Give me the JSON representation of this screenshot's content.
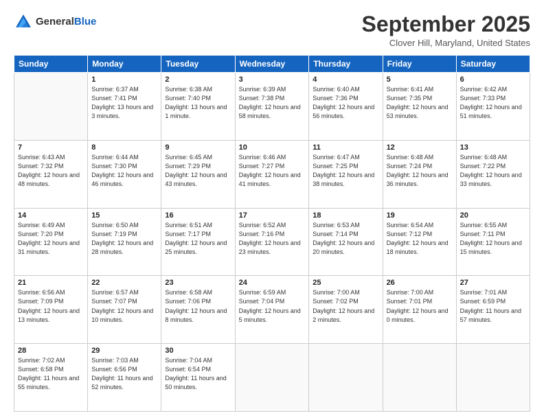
{
  "logo": {
    "general": "General",
    "blue": "Blue"
  },
  "header": {
    "month": "September 2025",
    "location": "Clover Hill, Maryland, United States"
  },
  "days_of_week": [
    "Sunday",
    "Monday",
    "Tuesday",
    "Wednesday",
    "Thursday",
    "Friday",
    "Saturday"
  ],
  "weeks": [
    [
      {
        "day": "",
        "sunrise": "",
        "sunset": "",
        "daylight": ""
      },
      {
        "day": "1",
        "sunrise": "Sunrise: 6:37 AM",
        "sunset": "Sunset: 7:41 PM",
        "daylight": "Daylight: 13 hours and 3 minutes."
      },
      {
        "day": "2",
        "sunrise": "Sunrise: 6:38 AM",
        "sunset": "Sunset: 7:40 PM",
        "daylight": "Daylight: 13 hours and 1 minute."
      },
      {
        "day": "3",
        "sunrise": "Sunrise: 6:39 AM",
        "sunset": "Sunset: 7:38 PM",
        "daylight": "Daylight: 12 hours and 58 minutes."
      },
      {
        "day": "4",
        "sunrise": "Sunrise: 6:40 AM",
        "sunset": "Sunset: 7:36 PM",
        "daylight": "Daylight: 12 hours and 56 minutes."
      },
      {
        "day": "5",
        "sunrise": "Sunrise: 6:41 AM",
        "sunset": "Sunset: 7:35 PM",
        "daylight": "Daylight: 12 hours and 53 minutes."
      },
      {
        "day": "6",
        "sunrise": "Sunrise: 6:42 AM",
        "sunset": "Sunset: 7:33 PM",
        "daylight": "Daylight: 12 hours and 51 minutes."
      }
    ],
    [
      {
        "day": "7",
        "sunrise": "Sunrise: 6:43 AM",
        "sunset": "Sunset: 7:32 PM",
        "daylight": "Daylight: 12 hours and 48 minutes."
      },
      {
        "day": "8",
        "sunrise": "Sunrise: 6:44 AM",
        "sunset": "Sunset: 7:30 PM",
        "daylight": "Daylight: 12 hours and 46 minutes."
      },
      {
        "day": "9",
        "sunrise": "Sunrise: 6:45 AM",
        "sunset": "Sunset: 7:29 PM",
        "daylight": "Daylight: 12 hours and 43 minutes."
      },
      {
        "day": "10",
        "sunrise": "Sunrise: 6:46 AM",
        "sunset": "Sunset: 7:27 PM",
        "daylight": "Daylight: 12 hours and 41 minutes."
      },
      {
        "day": "11",
        "sunrise": "Sunrise: 6:47 AM",
        "sunset": "Sunset: 7:25 PM",
        "daylight": "Daylight: 12 hours and 38 minutes."
      },
      {
        "day": "12",
        "sunrise": "Sunrise: 6:48 AM",
        "sunset": "Sunset: 7:24 PM",
        "daylight": "Daylight: 12 hours and 36 minutes."
      },
      {
        "day": "13",
        "sunrise": "Sunrise: 6:48 AM",
        "sunset": "Sunset: 7:22 PM",
        "daylight": "Daylight: 12 hours and 33 minutes."
      }
    ],
    [
      {
        "day": "14",
        "sunrise": "Sunrise: 6:49 AM",
        "sunset": "Sunset: 7:20 PM",
        "daylight": "Daylight: 12 hours and 31 minutes."
      },
      {
        "day": "15",
        "sunrise": "Sunrise: 6:50 AM",
        "sunset": "Sunset: 7:19 PM",
        "daylight": "Daylight: 12 hours and 28 minutes."
      },
      {
        "day": "16",
        "sunrise": "Sunrise: 6:51 AM",
        "sunset": "Sunset: 7:17 PM",
        "daylight": "Daylight: 12 hours and 25 minutes."
      },
      {
        "day": "17",
        "sunrise": "Sunrise: 6:52 AM",
        "sunset": "Sunset: 7:16 PM",
        "daylight": "Daylight: 12 hours and 23 minutes."
      },
      {
        "day": "18",
        "sunrise": "Sunrise: 6:53 AM",
        "sunset": "Sunset: 7:14 PM",
        "daylight": "Daylight: 12 hours and 20 minutes."
      },
      {
        "day": "19",
        "sunrise": "Sunrise: 6:54 AM",
        "sunset": "Sunset: 7:12 PM",
        "daylight": "Daylight: 12 hours and 18 minutes."
      },
      {
        "day": "20",
        "sunrise": "Sunrise: 6:55 AM",
        "sunset": "Sunset: 7:11 PM",
        "daylight": "Daylight: 12 hours and 15 minutes."
      }
    ],
    [
      {
        "day": "21",
        "sunrise": "Sunrise: 6:56 AM",
        "sunset": "Sunset: 7:09 PM",
        "daylight": "Daylight: 12 hours and 13 minutes."
      },
      {
        "day": "22",
        "sunrise": "Sunrise: 6:57 AM",
        "sunset": "Sunset: 7:07 PM",
        "daylight": "Daylight: 12 hours and 10 minutes."
      },
      {
        "day": "23",
        "sunrise": "Sunrise: 6:58 AM",
        "sunset": "Sunset: 7:06 PM",
        "daylight": "Daylight: 12 hours and 8 minutes."
      },
      {
        "day": "24",
        "sunrise": "Sunrise: 6:59 AM",
        "sunset": "Sunset: 7:04 PM",
        "daylight": "Daylight: 12 hours and 5 minutes."
      },
      {
        "day": "25",
        "sunrise": "Sunrise: 7:00 AM",
        "sunset": "Sunset: 7:02 PM",
        "daylight": "Daylight: 12 hours and 2 minutes."
      },
      {
        "day": "26",
        "sunrise": "Sunrise: 7:00 AM",
        "sunset": "Sunset: 7:01 PM",
        "daylight": "Daylight: 12 hours and 0 minutes."
      },
      {
        "day": "27",
        "sunrise": "Sunrise: 7:01 AM",
        "sunset": "Sunset: 6:59 PM",
        "daylight": "Daylight: 11 hours and 57 minutes."
      }
    ],
    [
      {
        "day": "28",
        "sunrise": "Sunrise: 7:02 AM",
        "sunset": "Sunset: 6:58 PM",
        "daylight": "Daylight: 11 hours and 55 minutes."
      },
      {
        "day": "29",
        "sunrise": "Sunrise: 7:03 AM",
        "sunset": "Sunset: 6:56 PM",
        "daylight": "Daylight: 11 hours and 52 minutes."
      },
      {
        "day": "30",
        "sunrise": "Sunrise: 7:04 AM",
        "sunset": "Sunset: 6:54 PM",
        "daylight": "Daylight: 11 hours and 50 minutes."
      },
      {
        "day": "",
        "sunrise": "",
        "sunset": "",
        "daylight": ""
      },
      {
        "day": "",
        "sunrise": "",
        "sunset": "",
        "daylight": ""
      },
      {
        "day": "",
        "sunrise": "",
        "sunset": "",
        "daylight": ""
      },
      {
        "day": "",
        "sunrise": "",
        "sunset": "",
        "daylight": ""
      }
    ]
  ]
}
